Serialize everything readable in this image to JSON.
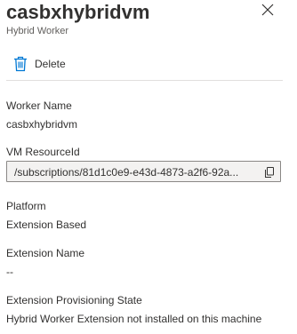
{
  "header": {
    "title": "casbxhybridvm",
    "subtitle": "Hybrid Worker"
  },
  "toolbar": {
    "delete_label": "Delete"
  },
  "fields": {
    "worker_name": {
      "label": "Worker Name",
      "value": "casbxhybridvm"
    },
    "vm_resource_id": {
      "label": "VM ResourceId",
      "value": "/subscriptions/81d1c0e9-e43d-4873-a2f6-92a..."
    },
    "platform": {
      "label": "Platform",
      "value": "Extension Based"
    },
    "extension_name": {
      "label": "Extension Name",
      "value": "--"
    },
    "extension_state": {
      "label": "Extension Provisioning State",
      "value": "Hybrid Worker Extension not installed on this machine"
    }
  },
  "icons": {
    "close": "close-icon",
    "delete": "trash-icon",
    "copy": "copy-icon"
  },
  "colors": {
    "accent": "#0078d4",
    "text": "#323130",
    "secondary_text": "#605e5c",
    "readonly_bg": "#f3f2f1"
  }
}
